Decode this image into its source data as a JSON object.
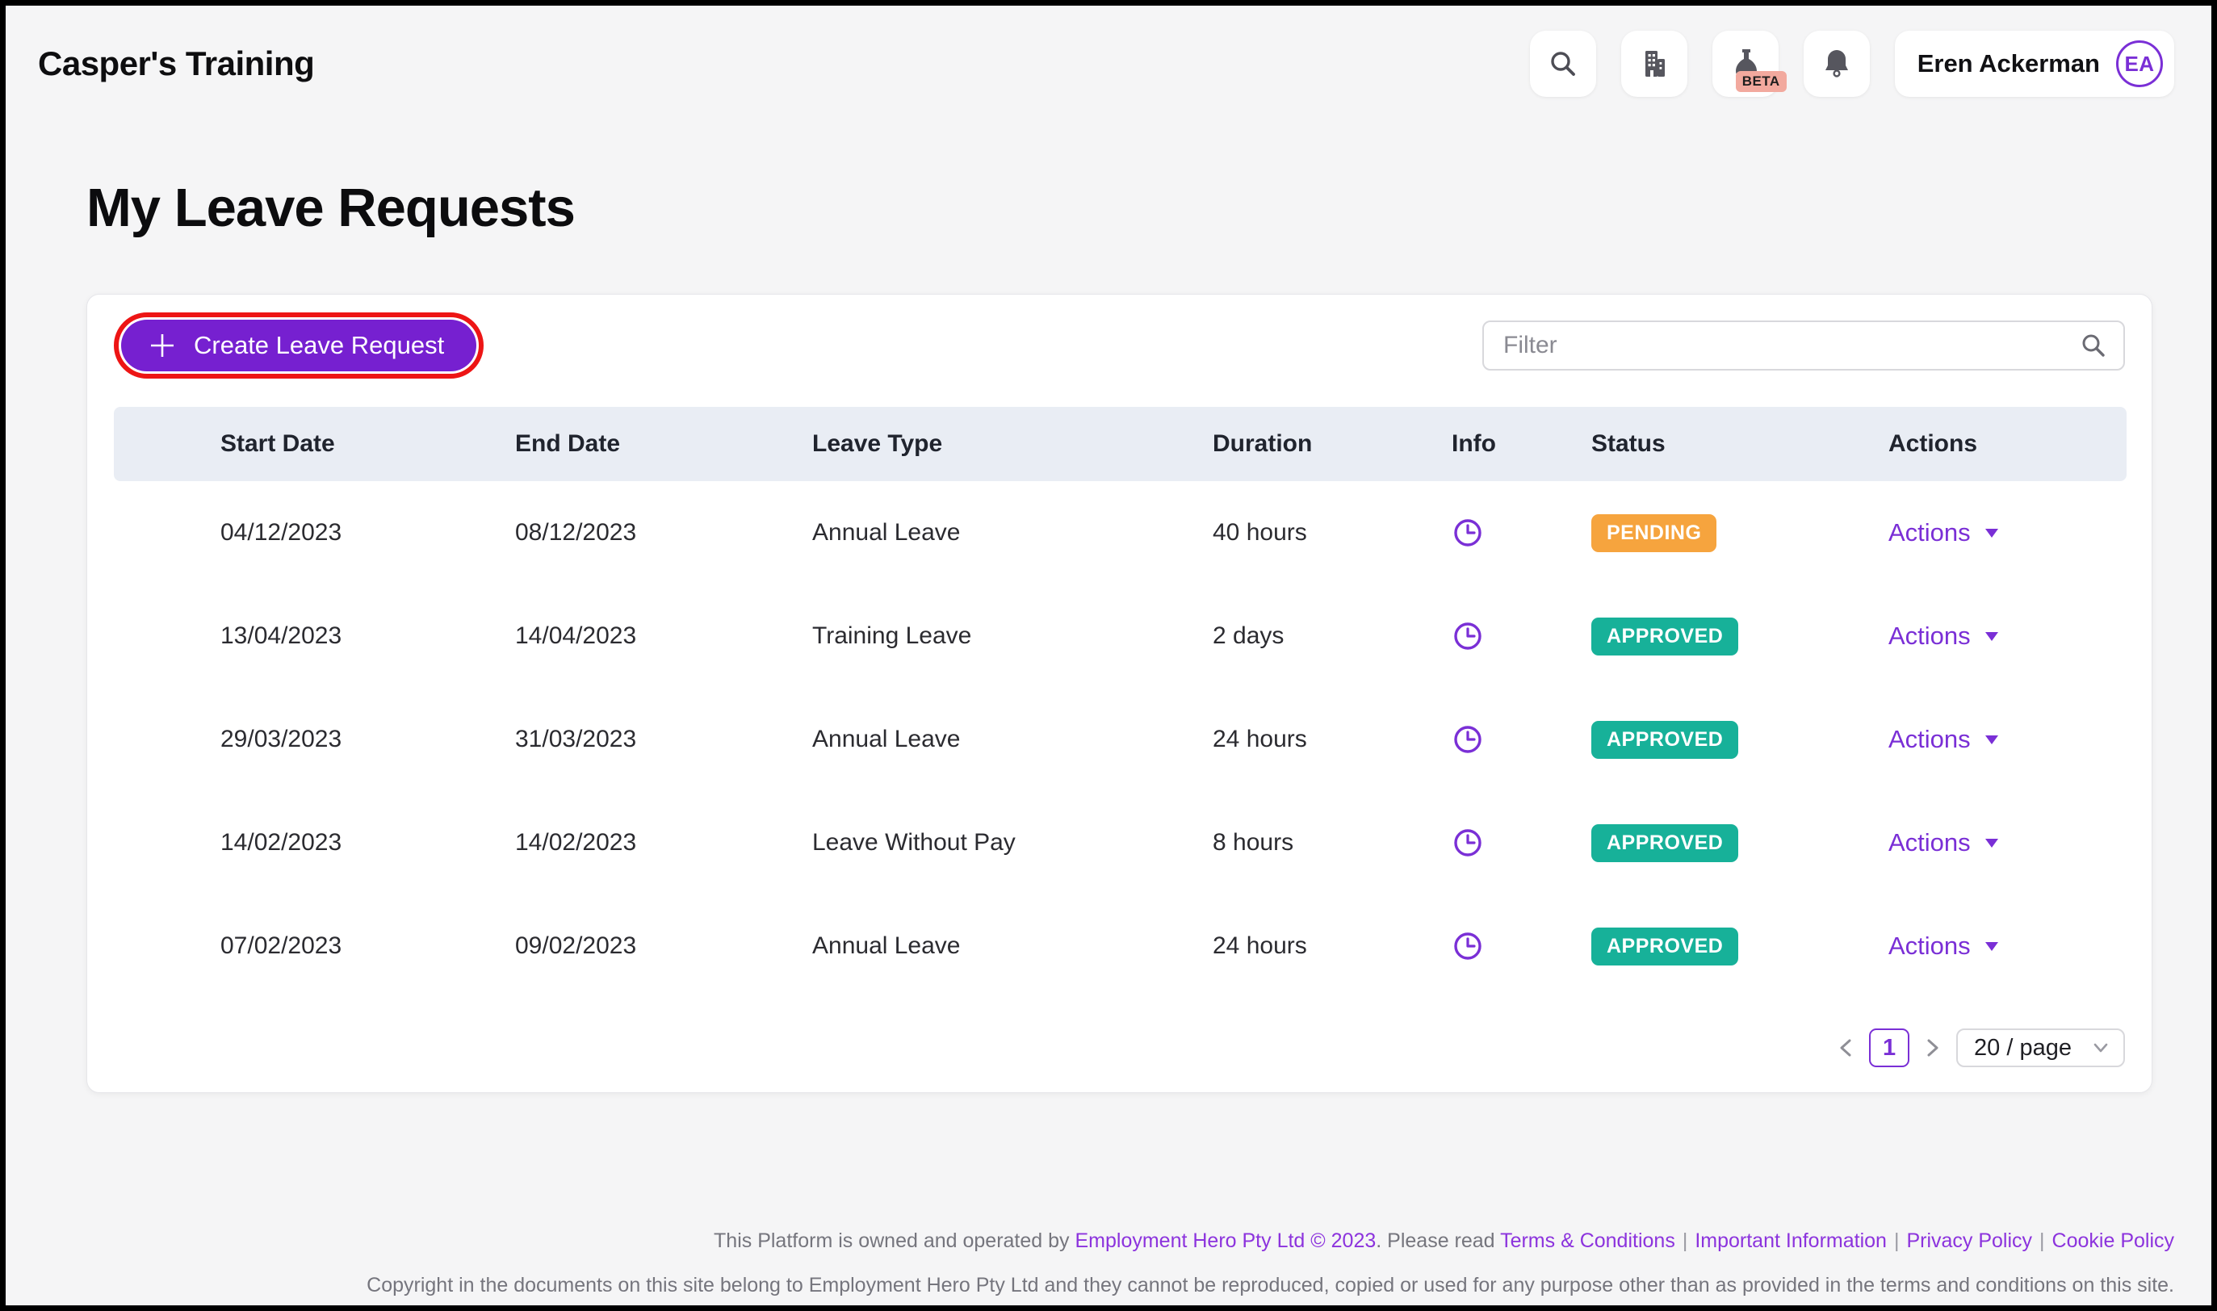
{
  "app": {
    "title": "Casper's Training"
  },
  "topbar": {
    "icons": {
      "search": "search",
      "organisation": "building",
      "beta": "flask",
      "beta_badge": "BETA",
      "notifications": "bell"
    },
    "user": {
      "name": "Eren Ackerman",
      "initials": "EA"
    }
  },
  "page": {
    "title": "My Leave Requests"
  },
  "toolbar": {
    "create_button_label": "Create Leave Request",
    "filter_placeholder": "Filter"
  },
  "table": {
    "headers": [
      "Start Date",
      "End Date",
      "Leave Type",
      "Duration",
      "Info",
      "Status",
      "Actions"
    ],
    "rows": [
      {
        "start_date": "04/12/2023",
        "end_date": "08/12/2023",
        "leave_type": "Annual Leave",
        "duration": "40 hours",
        "status": "PENDING",
        "actions_label": "Actions"
      },
      {
        "start_date": "13/04/2023",
        "end_date": "14/04/2023",
        "leave_type": "Training Leave",
        "duration": "2 days",
        "status": "APPROVED",
        "actions_label": "Actions"
      },
      {
        "start_date": "29/03/2023",
        "end_date": "31/03/2023",
        "leave_type": "Annual Leave",
        "duration": "24 hours",
        "status": "APPROVED",
        "actions_label": "Actions"
      },
      {
        "start_date": "14/02/2023",
        "end_date": "14/02/2023",
        "leave_type": "Leave Without Pay",
        "duration": "8 hours",
        "status": "APPROVED",
        "actions_label": "Actions"
      },
      {
        "start_date": "07/02/2023",
        "end_date": "09/02/2023",
        "leave_type": "Annual Leave",
        "duration": "24 hours",
        "status": "APPROVED",
        "actions_label": "Actions"
      }
    ]
  },
  "pagination": {
    "current_page": "1",
    "page_size": "20 / page"
  },
  "footer": {
    "line1_prefix": "This Platform is owned and operated by ",
    "line1_company": "Employment Hero Pty Ltd © 2023",
    "line1_mid": ". Please read ",
    "separator": "|",
    "links": [
      "Terms & Conditions",
      "Important Information",
      "Privacy Policy",
      "Cookie Policy"
    ],
    "line2": "Copyright in the documents on this site belong to Employment Hero Pty Ltd and they cannot be reproduced, copied or used for any purpose other than as provided in the terms and conditions on this site."
  },
  "colors": {
    "accent_purple": "#7a2fd6",
    "button_purple": "#7620d0",
    "highlight_ring_red": "#ed1515",
    "status_pending": "#f6a43e",
    "status_approved": "#17b199",
    "beta_badge_bg": "#f2a99e",
    "table_header_bg": "#e9edf4",
    "page_bg": "#f5f5f6",
    "footer_link_purple": "#8c33dd"
  }
}
